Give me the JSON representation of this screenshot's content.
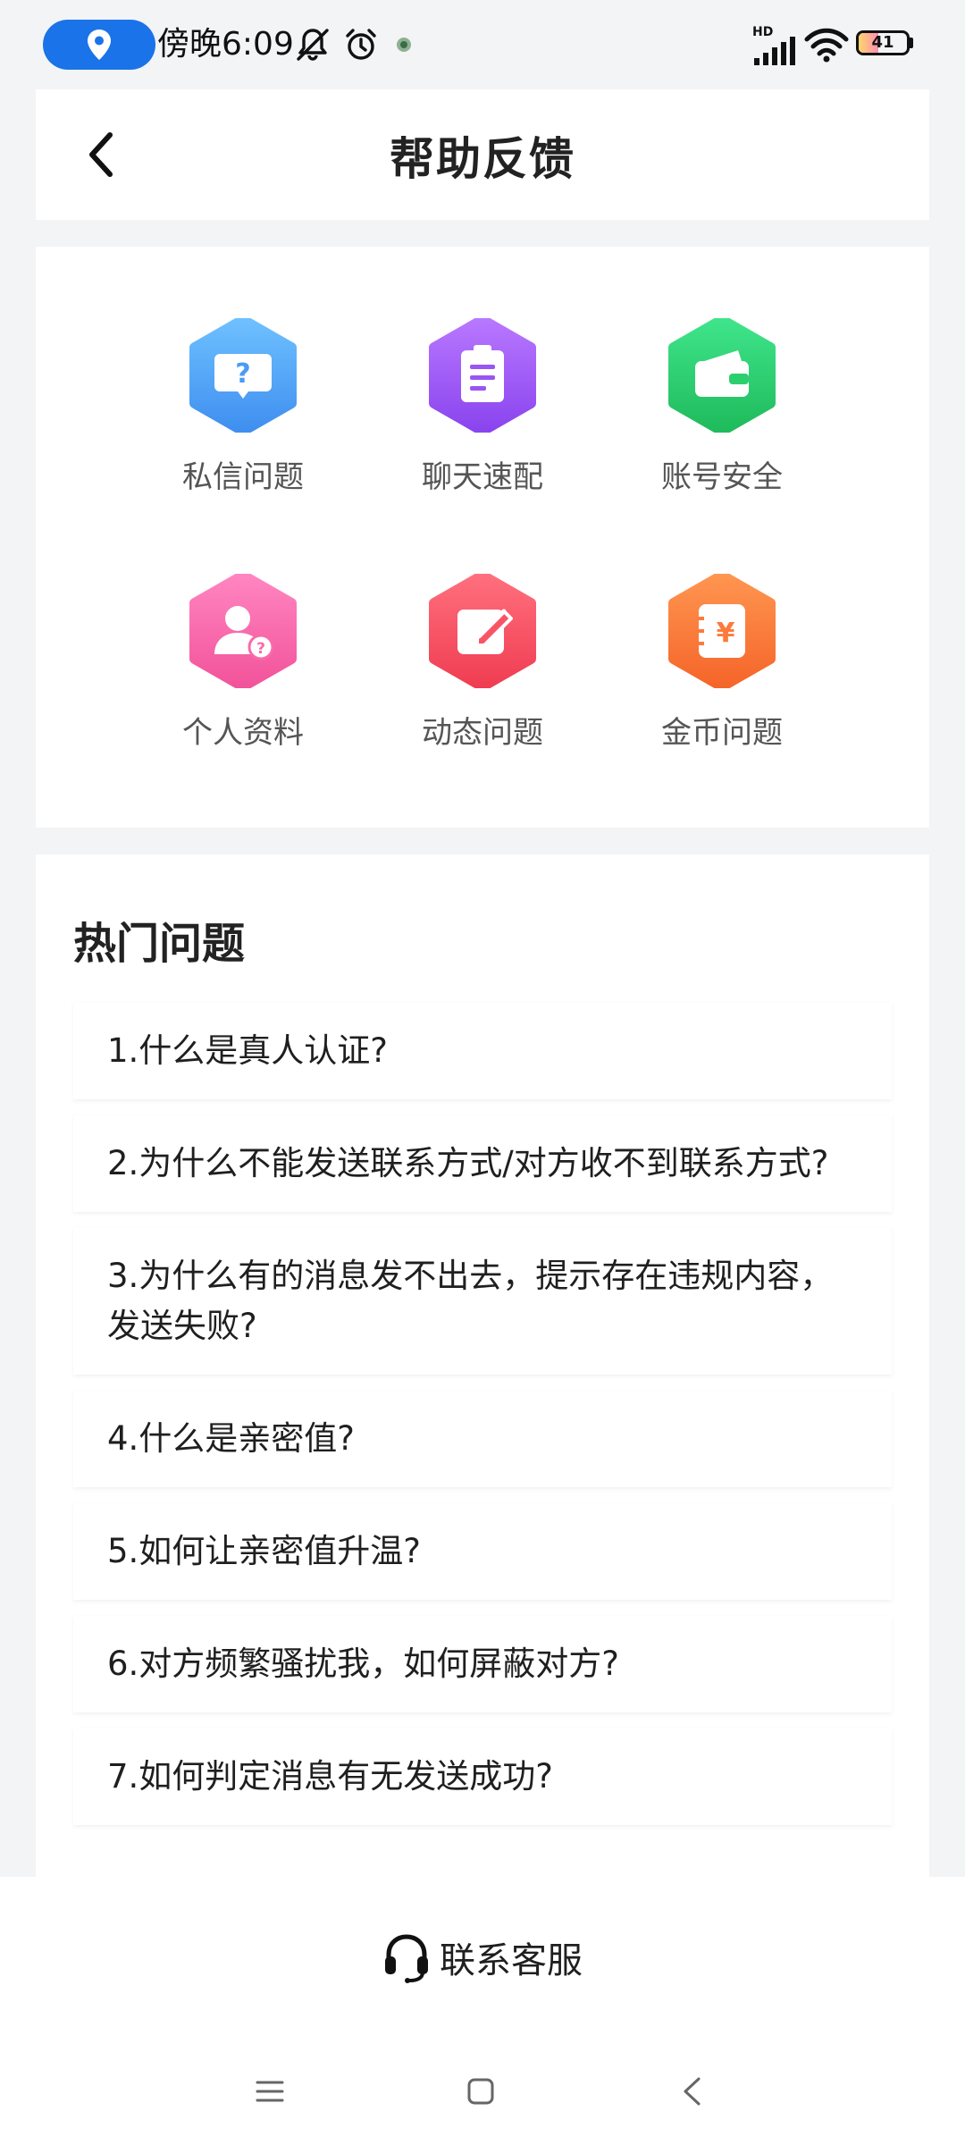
{
  "status_bar": {
    "time": "傍晚6:09",
    "network": "HD",
    "battery": "41",
    "battery_level": 0.41
  },
  "header": {
    "title": "帮助反馈",
    "back_icon": "chevron-left-icon"
  },
  "categories": [
    {
      "label": "私信问题",
      "icon": "question-bubble-icon",
      "color": "#5aa9f8"
    },
    {
      "label": "聊天速配",
      "icon": "clipboard-icon",
      "color": "#a25bf4"
    },
    {
      "label": "账号安全",
      "icon": "wallet-icon",
      "color": "#2ccf6e"
    },
    {
      "label": "个人资料",
      "icon": "user-question-icon",
      "color": "#f96aa8"
    },
    {
      "label": "动态问题",
      "icon": "edit-icon",
      "color": "#f75566"
    },
    {
      "label": "金币问题",
      "icon": "yuan-coin-icon",
      "color": "#fb7a3c"
    }
  ],
  "faq": {
    "title": "热门问题",
    "items": [
      "1.什么是真人认证?",
      "2.为什么不能发送联系方式/对方收不到联系方式?",
      "3.为什么有的消息发不出去，提示存在违规内容，发送失败?",
      "4.什么是亲密值?",
      "5.如何让亲密值升温?",
      "6.对方频繁骚扰我，如何屏蔽对方?",
      "7.如何判定消息有无发送成功?"
    ]
  },
  "contact": {
    "label": "联系客服",
    "icon": "headset-icon"
  },
  "nav_bar": {
    "menu_icon": "menu-icon",
    "home_icon": "home-square-icon",
    "back_icon": "back-triangle-icon"
  }
}
